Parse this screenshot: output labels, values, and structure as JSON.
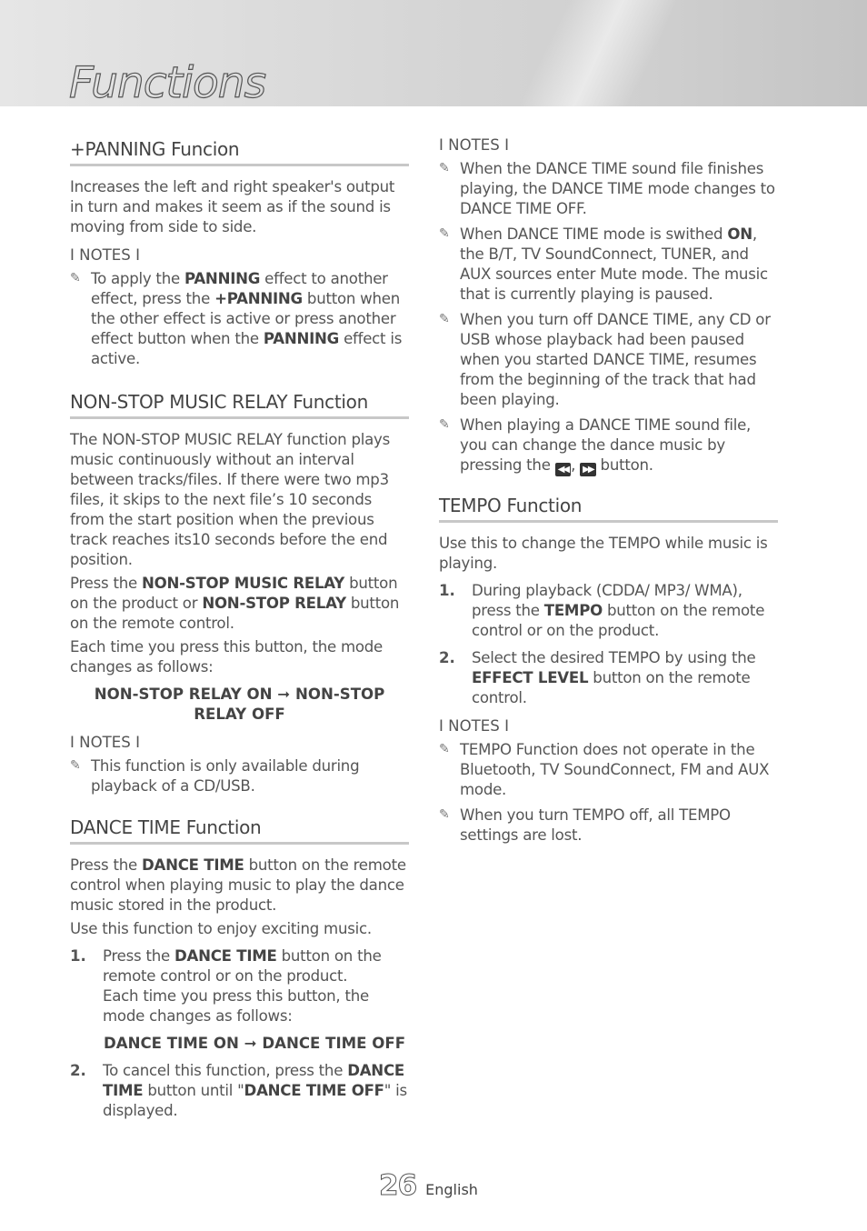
{
  "page": {
    "title": "Functions",
    "page_number": "26",
    "language": "English"
  },
  "sections": {
    "panning": {
      "heading": "+PANNING Funcion",
      "body": "Increases the left and right speaker's output in turn and makes it seem as if the sound is moving from side to side.",
      "notes_label": "I NOTES I",
      "notes": [
        {
          "parts": [
            "To apply the ",
            "PANNING",
            " effect to another effect, press the ",
            "+PANNING",
            " button when the other effect is active or press another effect button when the ",
            "PANNING",
            " effect is active."
          ]
        }
      ]
    },
    "nonstop": {
      "heading": "NON-STOP MUSIC RELAY Function",
      "body1": "The NON-STOP MUSIC RELAY function plays music continuously without an interval between tracks/files. If there were two mp3 files, it skips to the next file’s 10 seconds from the start position when the previous track reaches its10 seconds before the end position.",
      "body2_parts": [
        "Press the ",
        "NON-STOP MUSIC RELAY",
        " button on the product or ",
        "NON-STOP RELAY",
        " button on the remote control."
      ],
      "body3": "Each time you press this button, the mode changes as follows:",
      "mode_sequence": "NON-STOP RELAY ON ➞ NON-STOP RELAY OFF",
      "notes_label": "I NOTES I",
      "notes": [
        {
          "text": "This function is only available during playback of a CD/USB."
        }
      ]
    },
    "dance": {
      "heading": "DANCE TIME Function",
      "body1_parts": [
        "Press the ",
        "DANCE TIME",
        " button on the remote control when playing music to play the dance music stored in the product."
      ],
      "body2": "Use this function to enjoy exciting music.",
      "steps": [
        {
          "num": "1.",
          "parts": [
            "Press the ",
            "DANCE TIME",
            " button on the remote control or on the product."
          ],
          "sub": "Each time you press this button, the mode changes as follows:",
          "mode_sequence": "DANCE TIME ON ➞ DANCE TIME OFF"
        },
        {
          "num": "2.",
          "parts": [
            "To cancel this function, press the ",
            "DANCE TIME",
            " button until \"",
            "DANCE TIME OFF",
            "\" is displayed."
          ]
        }
      ],
      "notes_label": "I NOTES I",
      "notes": [
        {
          "text": "When the DANCE TIME sound file finishes playing, the DANCE TIME mode changes to DANCE TIME OFF."
        },
        {
          "parts": [
            "When DANCE TIME mode is swithed ",
            "ON",
            ", the B/T, TV SoundConnect, TUNER, and AUX sources enter Mute mode. The music that is currently playing is paused."
          ]
        },
        {
          "text": "When you turn off DANCE TIME, any CD or USB whose playback had been paused when you started DANCE TIME, resumes from the beginning of the track that had been playing."
        },
        {
          "parts": [
            "When playing a DANCE TIME sound file, you can change the dance music by pressing the ",
            ", ",
            " button."
          ],
          "icons": [
            "skip-back-icon",
            "skip-forward-icon"
          ]
        }
      ]
    },
    "tempo": {
      "heading": "TEMPO Function",
      "body": "Use this to change the TEMPO while music is playing.",
      "steps": [
        {
          "num": "1.",
          "parts": [
            "During playback (CDDA/ MP3/ WMA), press the ",
            "TEMPO",
            " button on the remote control or on the product."
          ]
        },
        {
          "num": "2.",
          "parts": [
            "Select the desired TEMPO by using the ",
            "EFFECT LEVEL",
            " button on the remote control."
          ]
        }
      ],
      "notes_label": "I NOTES I",
      "notes": [
        {
          "text": "TEMPO Function does not operate in the Bluetooth, TV SoundConnect, FM and AUX mode."
        },
        {
          "text": "When you turn TEMPO off, all TEMPO settings are lost."
        }
      ]
    }
  },
  "icons": {
    "note": "✎",
    "skip_back": "⏮",
    "skip_forward": "⏭"
  }
}
